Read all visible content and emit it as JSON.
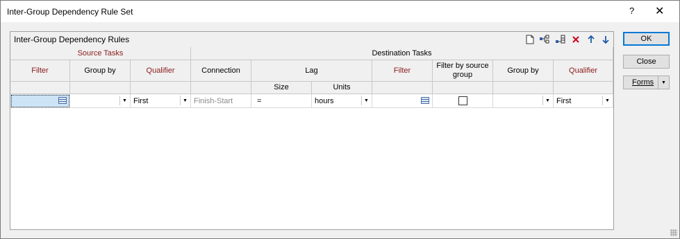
{
  "window": {
    "title": "Inter-Group Dependency Rule Set",
    "help_label": "?",
    "close_label": "✕"
  },
  "panel": {
    "title": "Inter-Group Dependency Rules",
    "toolbar": [
      "new-document-icon",
      "add-child-icon",
      "insert-row-icon",
      "delete-icon",
      "move-up-icon",
      "move-down-icon"
    ]
  },
  "grid": {
    "groups": {
      "source": "Source Tasks",
      "destination": "Destination Tasks"
    },
    "columns": {
      "src_filter": "Filter",
      "src_group_by": "Group by",
      "src_qualifier": "Qualifier",
      "connection": "Connection",
      "lag": "Lag",
      "lag_size": "Size",
      "lag_units": "Units",
      "dst_filter": "Filter",
      "filter_by_source_group": "Filter by source group",
      "dst_group_by": "Group by",
      "dst_qualifier": "Qualifier"
    },
    "row": {
      "src_filter": "",
      "src_group_by": "",
      "src_qualifier": "First",
      "connection": "Finish-Start",
      "lag_size": "=",
      "lag_units": "hours",
      "dst_filter": "",
      "filter_by_source_group": false,
      "dst_group_by": "",
      "dst_qualifier": "First"
    }
  },
  "buttons": {
    "ok": "OK",
    "close": "Close",
    "forms": "Forms"
  },
  "colors": {
    "required_header": "#8b1a1a",
    "accent": "#0078d7",
    "selection": "#cde4f7"
  }
}
